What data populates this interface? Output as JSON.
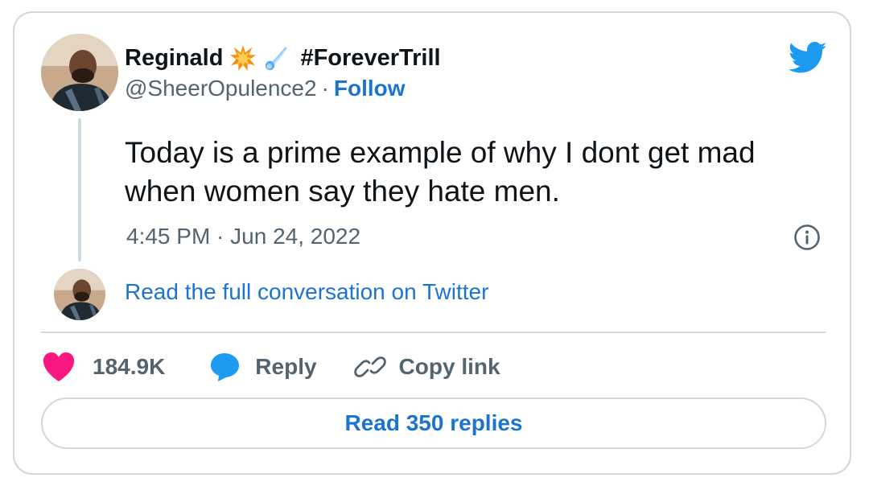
{
  "tweet": {
    "author": {
      "display_name": "Reginald",
      "name_emojis": [
        "collision-emoji",
        "comet-emoji"
      ],
      "hashtag": "#ForeverTrill",
      "handle": "@SheerOpulence2",
      "separator": "·",
      "follow_label": "Follow"
    },
    "text": "Today is a prime example of why I dont get mad when women say they hate men.",
    "timestamp": "4:45 PM · Jun 24, 2022",
    "conversation_link": "Read the full conversation on Twitter",
    "actions": {
      "likes_count": "184.9K",
      "reply_label": "Reply",
      "copy_link_label": "Copy link"
    },
    "read_replies_label": "Read 350 replies",
    "icons": {
      "brand": "twitter-bird-icon",
      "info": "info-icon",
      "like": "heart-icon",
      "reply": "speech-bubble-icon",
      "copy": "link-icon"
    }
  },
  "colors": {
    "text_primary": "#0f1419",
    "text_secondary": "#536471",
    "link": "#1d74d0",
    "twitter_blue": "#1d9bf0",
    "like_pink": "#f91880",
    "border": "#cfd9de"
  }
}
